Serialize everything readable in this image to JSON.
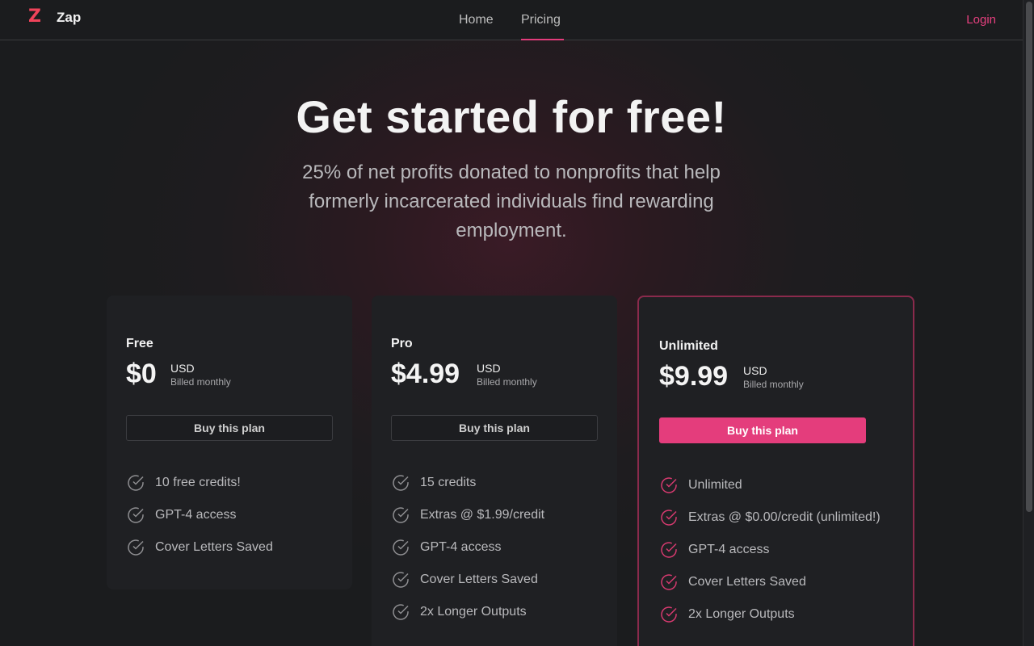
{
  "header": {
    "logo_mark": "Z",
    "app_name": "Zap",
    "nav": [
      {
        "label": "Home"
      },
      {
        "label": "Pricing",
        "active": true
      }
    ],
    "login_label": "Login"
  },
  "hero": {
    "title": "Get started for free!",
    "subtitle": "25% of net profits donated to nonprofits that help formerly incarcerated individuals find rewarding employment."
  },
  "plans": [
    {
      "name": "Free",
      "price": "$0",
      "currency": "USD",
      "billing": "Billed monthly",
      "cta": "Buy this plan",
      "features": [
        "10 free credits!",
        "GPT-4 access",
        "Cover Letters Saved"
      ]
    },
    {
      "name": "Pro",
      "price": "$4.99",
      "currency": "USD",
      "billing": "Billed monthly",
      "cta": "Buy this plan",
      "features": [
        "15 credits",
        "Extras @ $1.99/credit",
        "GPT-4 access",
        "Cover Letters Saved",
        "2x Longer Outputs"
      ]
    },
    {
      "name": "Unlimited",
      "price": "$9.99",
      "currency": "USD",
      "billing": "Billed monthly",
      "cta": "Buy this plan",
      "highlighted": true,
      "features": [
        "Unlimited",
        "Extras @ $0.00/credit (unlimited!)",
        "GPT-4 access",
        "Cover Letters Saved",
        "2x Longer Outputs"
      ]
    }
  ],
  "icons": {
    "check": "check-circle-icon"
  },
  "colors": {
    "accent": "#e43d7c",
    "logo": "#f0435a",
    "check_default": "#8e8e91",
    "check_highlight": "#d63a6f"
  }
}
